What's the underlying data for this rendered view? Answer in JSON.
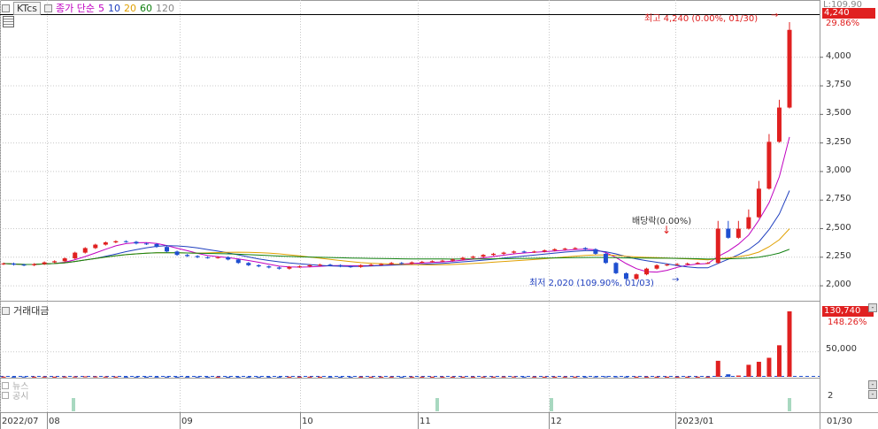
{
  "header": {
    "ticker": "KTcs",
    "ma_label": "종가 단순",
    "ma_periods": [
      "5",
      "10",
      "20",
      "60",
      "120"
    ],
    "ma_colors": [
      "#c000c0",
      "#1f3fbf",
      "#e0a000",
      "#108010",
      "#888888"
    ]
  },
  "right_axis": {
    "top_label": "L:109.90",
    "current_price": "4,240",
    "current_pct": "29.86%",
    "price_ticks": [
      "4,000",
      "3,750",
      "3,500",
      "3,250",
      "3,000",
      "2,750",
      "2,500",
      "2,250",
      "2,000"
    ],
    "volume_current": "130,740",
    "volume_pct": "148.26%",
    "volume_tick": "50,000",
    "notice_tick": "2"
  },
  "annotations": {
    "high": "최고 4,240 (0.00%, 01/30)",
    "low": "최저 2,020 (109.90%, 01/03)",
    "dividend": "배당락(0.00%)"
  },
  "volume_panel": {
    "title": "거래대금"
  },
  "bottom_panel": {
    "news": "뉴스",
    "disclosure": "공시"
  },
  "x_axis": {
    "labels": [
      "2022/07",
      "08",
      "09",
      "10",
      "11",
      "12",
      "2023/01",
      "01/30"
    ]
  },
  "colors": {
    "up": "#e02020",
    "down": "#1f4fd0",
    "grid": "#c8c8c8",
    "ma5": "#c000c0",
    "ma10": "#1f3fbf",
    "ma20": "#e0a000",
    "ma60": "#108010"
  },
  "chart_data": {
    "type": "candlestick",
    "ylim": [
      1900,
      4300
    ],
    "volume_ylim": [
      0,
      130740
    ],
    "series": [
      {
        "name": "price",
        "values": [
          2195,
          2185,
          2180,
          2190,
          2205,
          2215,
          2240,
          2290,
          2330,
          2360,
          2380,
          2390,
          2385,
          2370,
          2365,
          2340,
          2300,
          2270,
          2260,
          2250,
          2245,
          2250,
          2230,
          2200,
          2180,
          2170,
          2160,
          2150,
          2165,
          2170,
          2180,
          2185,
          2180,
          2170,
          2165,
          2180,
          2185,
          2190,
          2200,
          2195,
          2205,
          2210,
          2215,
          2220,
          2230,
          2245,
          2255,
          2270,
          2280,
          2290,
          2300,
          2295,
          2300,
          2310,
          2320,
          2325,
          2330,
          2320,
          2280,
          2200,
          2110,
          2060,
          2100,
          2150,
          2180,
          2185,
          2190,
          2195,
          2200,
          2200,
          2500,
          2420,
          2500,
          2600,
          2850,
          3260,
          3560,
          4240
        ]
      },
      {
        "name": "거래대금",
        "values": [
          400,
          300,
          500,
          300,
          400,
          300,
          500,
          600,
          900,
          700,
          500,
          400,
          300,
          300,
          300,
          300,
          400,
          300,
          300,
          400,
          300,
          300,
          200,
          300,
          300,
          300,
          200,
          300,
          300,
          300,
          300,
          300,
          300,
          200,
          300,
          300,
          300,
          300,
          300,
          300,
          300,
          300,
          300,
          300,
          300,
          300,
          300,
          400,
          400,
          500,
          600,
          400,
          400,
          300,
          300,
          400,
          400,
          400,
          700,
          900,
          800,
          500,
          300,
          300,
          300,
          300,
          300,
          300,
          300,
          300,
          32000,
          5000,
          2500,
          24000,
          30000,
          38000,
          63000,
          130740
        ]
      }
    ]
  }
}
